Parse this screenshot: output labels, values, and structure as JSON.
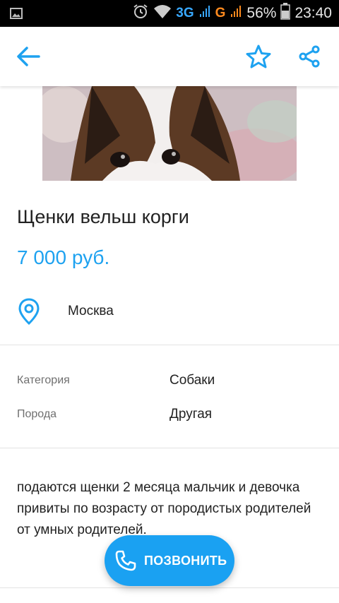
{
  "status_bar": {
    "network_3g": "3G",
    "network_g": "G",
    "battery_percent": "56%",
    "time": "23:40",
    "icons": [
      "image-notification-icon",
      "alarm-icon",
      "wifi-icon",
      "signal-icon",
      "battery-icon"
    ]
  },
  "appbar": {
    "icons": [
      "back-arrow-icon",
      "star-icon",
      "share-icon"
    ]
  },
  "listing": {
    "title": "Щенки вельш корги",
    "price": "7 000 руб.",
    "location": "Москва",
    "properties": [
      {
        "label": "Категория",
        "value": "Собаки"
      },
      {
        "label": "Порода",
        "value": "Другая"
      }
    ],
    "description": "подаются щенки 2 месяца мальчик и девочка привиты по возрасту от породистых родителей от умных родителей."
  },
  "call_button": {
    "label": "ПОЗВОНИТЬ",
    "icon": "phone-icon"
  },
  "colors": {
    "accent": "#1ea2f0",
    "button": "#1aa1f2",
    "status_3g": "#38a8ff",
    "status_g": "#ff8a1e"
  }
}
